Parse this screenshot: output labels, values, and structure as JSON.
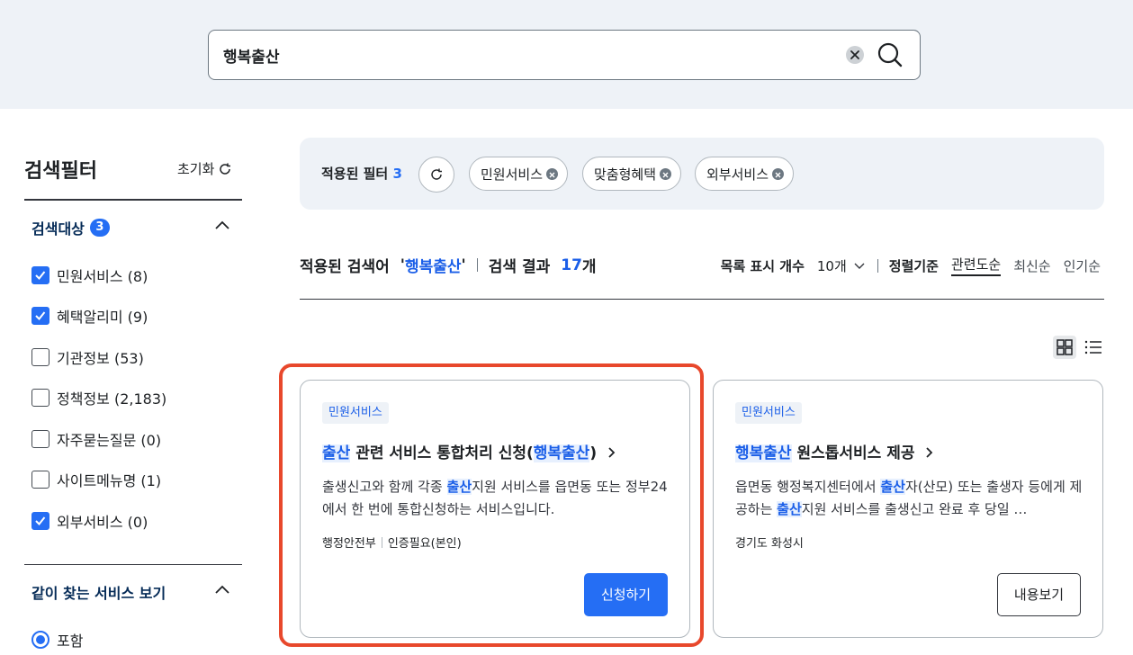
{
  "search": {
    "query": "행복출산"
  },
  "filter": {
    "title": "검색필터",
    "reset_label": "초기화",
    "target_section": {
      "title": "검색대상",
      "count": "3"
    },
    "targets": [
      {
        "label": "민원서비스 (8)",
        "checked": true
      },
      {
        "label": "혜택알리미 (9)",
        "checked": true
      },
      {
        "label": "기관정보 (53)",
        "checked": false
      },
      {
        "label": "정책정보 (2,183)",
        "checked": false
      },
      {
        "label": "자주묻는질문 (0)",
        "checked": false
      },
      {
        "label": "사이트메뉴명 (1)",
        "checked": false
      },
      {
        "label": "외부서비스 (0)",
        "checked": true
      }
    ],
    "related_section": {
      "title": "같이 찾는 서비스 보기",
      "option": "포함"
    }
  },
  "applied_filters": {
    "label": "적용된 필터",
    "count": "3",
    "chips": [
      "민원서비스",
      "맞춤형혜택",
      "외부서비스"
    ]
  },
  "results": {
    "label_applied": "적용된 검색어",
    "term": "행복출산",
    "label_count": "검색 결과",
    "count": "17",
    "count_unit": "개",
    "page_size_label": "목록 표시 개수",
    "page_size_value": "10개",
    "sort_label": "정렬기준",
    "sort_options": [
      "관련도순",
      "최신순",
      "인기순"
    ]
  },
  "cards": [
    {
      "tag": "민원서비스",
      "title_hl1": "출산",
      "title_mid": " 관련 서비스 통합처리 신청(",
      "title_hl2": "행복출산",
      "title_end": ")",
      "desc_pre": "출생신고와 함께 각종 ",
      "desc_hl": "출산",
      "desc_post": "지원 서비스를 읍면동 또는 정부24에서 한 번에 통합신청하는 서비스입니다.",
      "org": "행정안전부",
      "auth": "인증필요(본인)",
      "button": "신청하기"
    },
    {
      "tag": "민원서비스",
      "title_hl1": "행복출산",
      "title_mid": " 원스톱서비스 제공",
      "desc_pre": "읍면동 행정복지센터에서 ",
      "desc_hl": "출산",
      "desc_mid": "자(산모) 또는 출생자 등에게 제공하는 ",
      "desc_hl2": "출산",
      "desc_post": "지원 서비스를 출생신고 완료 후 당일 …",
      "org": "경기도 화성시",
      "button": "내용보기"
    }
  ],
  "colors": {
    "accent": "#256ef4",
    "highlight_frame": "#e8482c"
  }
}
